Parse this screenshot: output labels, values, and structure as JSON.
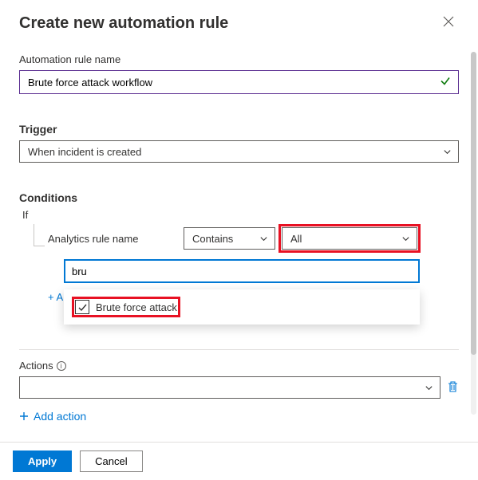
{
  "header": {
    "title": "Create new automation rule"
  },
  "ruleName": {
    "label": "Automation rule name",
    "value": "Brute force attack workflow"
  },
  "trigger": {
    "label": "Trigger",
    "value": "When incident is created"
  },
  "conditions": {
    "label": "Conditions",
    "if": "If",
    "field": "Analytics rule name",
    "operator": "Contains",
    "value": "All",
    "searchValue": "bru",
    "addLink": "+ A",
    "option": "Brute force attack"
  },
  "actions": {
    "label": "Actions",
    "addAction": "Add action"
  },
  "footer": {
    "apply": "Apply",
    "cancel": "Cancel"
  }
}
